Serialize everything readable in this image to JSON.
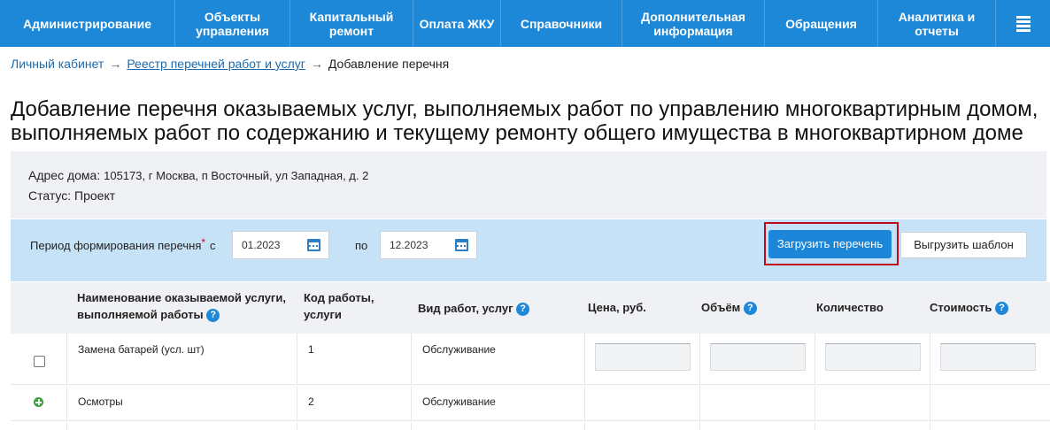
{
  "nav": {
    "items": [
      "Администрирование",
      "Объекты управления",
      "Капитальный ремонт",
      "Оплата ЖКУ",
      "Справочники",
      "Дополнительная информация",
      "Обращения",
      "Аналитика и отчеты"
    ],
    "menu_icon": "hamburger-menu-icon",
    "color": "#1d88d7"
  },
  "breadcrumb": {
    "home": "Личный кабинет",
    "registry": "Реестр перечней работ и услуг",
    "current": "Добавление перечня",
    "separator": "→"
  },
  "page": {
    "title_line1": "Добавление перечня оказываемых услуг, выполняемых работ по управлению многоквартирным домом,",
    "title_line2": "выполняемых работ по содержанию и текущему ремонту общего имущества в многоквартирном доме"
  },
  "info": {
    "address_label": "Адрес дома:",
    "address_value": "105173, г Москва, п Восточный, ул Западная, д. 2",
    "status_label": "Статус:",
    "status_value": "Проект"
  },
  "period": {
    "label": "Период формирования перечня",
    "required_mark": "*",
    "from_word": "с",
    "from_value": "01.2023",
    "to_word": "по",
    "to_value": "12.2023",
    "calendar_icon": "calendar-icon",
    "load_button": "Загрузить перечень",
    "export_button": "Выгрузить шаблон",
    "highlight_color": "#c0081a"
  },
  "table": {
    "headers": {
      "name_line1": "Наименование оказываемой услуги,",
      "name_line2": "выполняемой работы",
      "code_line1": "Код работы,",
      "code_line2": "услуги",
      "type": "Вид работ, услуг",
      "price": "Цена, руб.",
      "volume": "Объём",
      "quantity": "Количество",
      "cost": "Стоимость",
      "help_glyph": "?"
    },
    "rows": [
      {
        "name": "Замена батарей (усл. шт)",
        "code": "1",
        "type": "Обслуживание",
        "control": "checkbox"
      },
      {
        "name": "Осмотры",
        "code": "2",
        "type": "Обслуживание",
        "control": "add-icon"
      }
    ]
  }
}
